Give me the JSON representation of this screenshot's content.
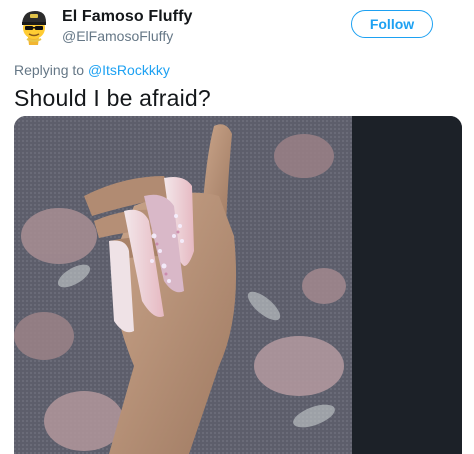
{
  "user": {
    "display_name": "El Famoso Fluffy",
    "handle": "@ElFamosoFluffy",
    "avatar_icon": "emoji-face-cap-icon"
  },
  "actions": {
    "follow_label": "Follow"
  },
  "reply": {
    "prefix": "Replying to",
    "target": "@ItsRockkky"
  },
  "tweet": {
    "text": "Should I be afraid?"
  },
  "colors": {
    "accent": "#1da1f2",
    "name": "#14171a",
    "secondary": "#657786",
    "media_dark_panel": "#1c2128"
  }
}
